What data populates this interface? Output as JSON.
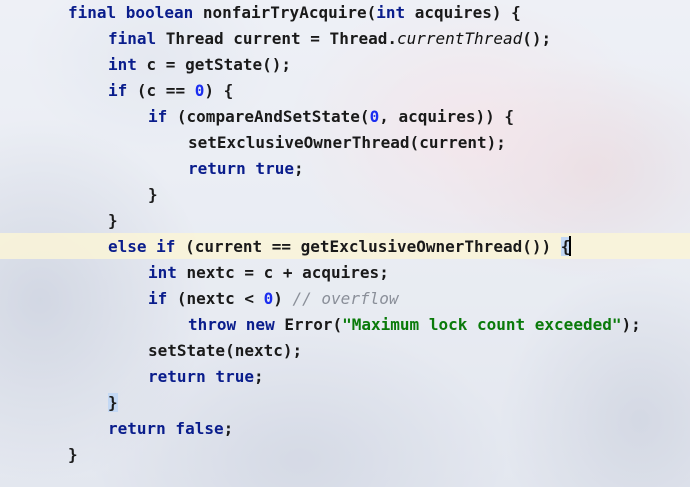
{
  "editor": {
    "lines": [
      {
        "indent": 1,
        "tokens": [
          {
            "t": "final boolean ",
            "c": "kw"
          },
          {
            "t": "nonfairTryAcquire(",
            "c": ""
          },
          {
            "t": "int ",
            "c": "kw"
          },
          {
            "t": "acquires) {",
            "c": ""
          }
        ]
      },
      {
        "indent": 2,
        "tokens": [
          {
            "t": "final ",
            "c": "kw"
          },
          {
            "t": "Thread current = Thread.",
            "c": ""
          },
          {
            "t": "currentThread",
            "c": "ital"
          },
          {
            "t": "();",
            "c": ""
          }
        ]
      },
      {
        "indent": 2,
        "tokens": [
          {
            "t": "int ",
            "c": "kw"
          },
          {
            "t": "c = getState();",
            "c": ""
          }
        ]
      },
      {
        "indent": 2,
        "tokens": [
          {
            "t": "if ",
            "c": "kw"
          },
          {
            "t": "(c == ",
            "c": ""
          },
          {
            "t": "0",
            "c": "num"
          },
          {
            "t": ") {",
            "c": ""
          }
        ]
      },
      {
        "indent": 3,
        "tokens": [
          {
            "t": "if ",
            "c": "kw"
          },
          {
            "t": "(compareAndSetState(",
            "c": ""
          },
          {
            "t": "0",
            "c": "num"
          },
          {
            "t": ", acquires)) {",
            "c": ""
          }
        ]
      },
      {
        "indent": 4,
        "tokens": [
          {
            "t": "setExclusiveOwnerThread(current);",
            "c": ""
          }
        ]
      },
      {
        "indent": 4,
        "tokens": [
          {
            "t": "return true",
            "c": "kw"
          },
          {
            "t": ";",
            "c": ""
          }
        ]
      },
      {
        "indent": 3,
        "tokens": [
          {
            "t": "}",
            "c": ""
          }
        ]
      },
      {
        "indent": 2,
        "tokens": [
          {
            "t": "}",
            "c": ""
          }
        ]
      },
      {
        "indent": 2,
        "current": true,
        "tokens": [
          {
            "t": "else if ",
            "c": "kw"
          },
          {
            "t": "(current == getExclusiveOwnerThread()) ",
            "c": ""
          },
          {
            "t": "{",
            "c": "brace-hl cursor-after"
          }
        ]
      },
      {
        "indent": 3,
        "tokens": [
          {
            "t": "int ",
            "c": "kw"
          },
          {
            "t": "nextc = c + acquires;",
            "c": ""
          }
        ]
      },
      {
        "indent": 3,
        "tokens": [
          {
            "t": "if ",
            "c": "kw"
          },
          {
            "t": "(nextc < ",
            "c": ""
          },
          {
            "t": "0",
            "c": "num"
          },
          {
            "t": ") ",
            "c": ""
          },
          {
            "t": "// overflow",
            "c": "cmt"
          }
        ]
      },
      {
        "indent": 4,
        "tokens": [
          {
            "t": "throw new ",
            "c": "kw"
          },
          {
            "t": "Error(",
            "c": ""
          },
          {
            "t": "\"Maximum lock count exceeded\"",
            "c": "str"
          },
          {
            "t": ");",
            "c": ""
          }
        ]
      },
      {
        "indent": 3,
        "tokens": [
          {
            "t": "setState(nextc);",
            "c": ""
          }
        ]
      },
      {
        "indent": 3,
        "tokens": [
          {
            "t": "return true",
            "c": "kw"
          },
          {
            "t": ";",
            "c": ""
          }
        ]
      },
      {
        "indent": 2,
        "tokens": [
          {
            "t": "}",
            "c": "brace-hl"
          }
        ]
      },
      {
        "indent": 2,
        "tokens": [
          {
            "t": "return false",
            "c": "kw"
          },
          {
            "t": ";",
            "c": ""
          }
        ]
      },
      {
        "indent": 1,
        "tokens": [
          {
            "t": "}",
            "c": ""
          }
        ]
      }
    ]
  },
  "colors": {
    "keyword": "#0a1d8c",
    "number": "#1b2ef0",
    "string": "#0a7a0a",
    "comment": "#8a8f99",
    "current_line": "#faf5d7",
    "brace_match": "#c3d8f4"
  }
}
